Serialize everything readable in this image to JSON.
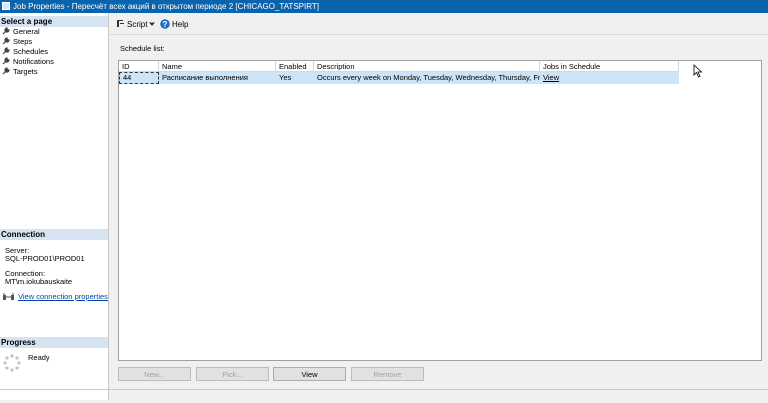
{
  "window": {
    "title": "Job Properties - Пересчёт всех акций в открытом периоде 2 [CHICAGO_TATSPIRT]"
  },
  "left_pane": {
    "select_page_header": "Select a page",
    "pages": [
      {
        "label": "General"
      },
      {
        "label": "Steps"
      },
      {
        "label": "Schedules"
      },
      {
        "label": "Notifications"
      },
      {
        "label": "Targets"
      }
    ],
    "connection": {
      "header": "Connection",
      "server_label": "Server:",
      "server_value": "SQL-PROD01\\PROD01",
      "connection_label": "Connection:",
      "connection_value": "MT\\m.iokubauskaite",
      "view_link": "View connection properties"
    },
    "progress": {
      "header": "Progress",
      "status": "Ready"
    }
  },
  "toolbar": {
    "script_label": "Script",
    "help_label": "Help"
  },
  "schedule": {
    "list_label": "Schedule list:",
    "columns": [
      "ID",
      "Name",
      "Enabled",
      "Description",
      "Jobs in Schedule"
    ],
    "rows": [
      {
        "id": "44",
        "name": "Расписание выполнения",
        "enabled": "Yes",
        "description": "Occurs every week on Monday, Tuesday, Wednesday, Thursday, Fri...",
        "jobs": "View"
      }
    ]
  },
  "buttons": {
    "new": "New...",
    "pick": "Pick...",
    "view": "View",
    "remove": "Remove"
  },
  "colors": {
    "titlebar": "#0a64ad",
    "section_header": "#d6e4f2",
    "selected_row": "#cce4f7"
  }
}
